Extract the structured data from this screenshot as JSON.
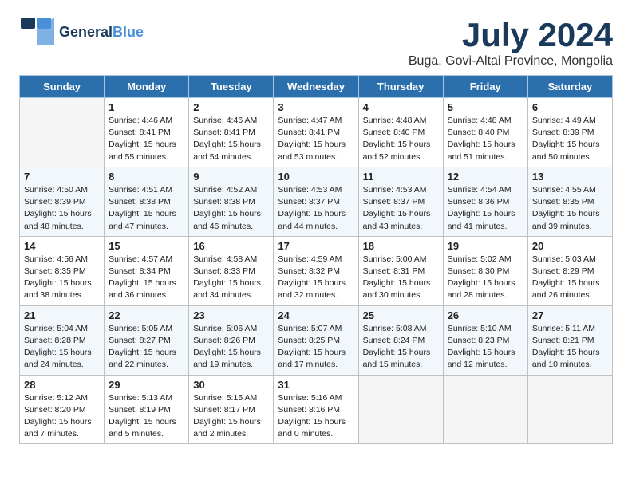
{
  "header": {
    "logo_general": "General",
    "logo_blue": "Blue",
    "month": "July 2024",
    "location": "Buga, Govi-Altai Province, Mongolia"
  },
  "days_of_week": [
    "Sunday",
    "Monday",
    "Tuesday",
    "Wednesday",
    "Thursday",
    "Friday",
    "Saturday"
  ],
  "weeks": [
    [
      {
        "day": "",
        "info": ""
      },
      {
        "day": "1",
        "info": "Sunrise: 4:46 AM\nSunset: 8:41 PM\nDaylight: 15 hours\nand 55 minutes."
      },
      {
        "day": "2",
        "info": "Sunrise: 4:46 AM\nSunset: 8:41 PM\nDaylight: 15 hours\nand 54 minutes."
      },
      {
        "day": "3",
        "info": "Sunrise: 4:47 AM\nSunset: 8:41 PM\nDaylight: 15 hours\nand 53 minutes."
      },
      {
        "day": "4",
        "info": "Sunrise: 4:48 AM\nSunset: 8:40 PM\nDaylight: 15 hours\nand 52 minutes."
      },
      {
        "day": "5",
        "info": "Sunrise: 4:48 AM\nSunset: 8:40 PM\nDaylight: 15 hours\nand 51 minutes."
      },
      {
        "day": "6",
        "info": "Sunrise: 4:49 AM\nSunset: 8:39 PM\nDaylight: 15 hours\nand 50 minutes."
      }
    ],
    [
      {
        "day": "7",
        "info": "Sunrise: 4:50 AM\nSunset: 8:39 PM\nDaylight: 15 hours\nand 48 minutes."
      },
      {
        "day": "8",
        "info": "Sunrise: 4:51 AM\nSunset: 8:38 PM\nDaylight: 15 hours\nand 47 minutes."
      },
      {
        "day": "9",
        "info": "Sunrise: 4:52 AM\nSunset: 8:38 PM\nDaylight: 15 hours\nand 46 minutes."
      },
      {
        "day": "10",
        "info": "Sunrise: 4:53 AM\nSunset: 8:37 PM\nDaylight: 15 hours\nand 44 minutes."
      },
      {
        "day": "11",
        "info": "Sunrise: 4:53 AM\nSunset: 8:37 PM\nDaylight: 15 hours\nand 43 minutes."
      },
      {
        "day": "12",
        "info": "Sunrise: 4:54 AM\nSunset: 8:36 PM\nDaylight: 15 hours\nand 41 minutes."
      },
      {
        "day": "13",
        "info": "Sunrise: 4:55 AM\nSunset: 8:35 PM\nDaylight: 15 hours\nand 39 minutes."
      }
    ],
    [
      {
        "day": "14",
        "info": "Sunrise: 4:56 AM\nSunset: 8:35 PM\nDaylight: 15 hours\nand 38 minutes."
      },
      {
        "day": "15",
        "info": "Sunrise: 4:57 AM\nSunset: 8:34 PM\nDaylight: 15 hours\nand 36 minutes."
      },
      {
        "day": "16",
        "info": "Sunrise: 4:58 AM\nSunset: 8:33 PM\nDaylight: 15 hours\nand 34 minutes."
      },
      {
        "day": "17",
        "info": "Sunrise: 4:59 AM\nSunset: 8:32 PM\nDaylight: 15 hours\nand 32 minutes."
      },
      {
        "day": "18",
        "info": "Sunrise: 5:00 AM\nSunset: 8:31 PM\nDaylight: 15 hours\nand 30 minutes."
      },
      {
        "day": "19",
        "info": "Sunrise: 5:02 AM\nSunset: 8:30 PM\nDaylight: 15 hours\nand 28 minutes."
      },
      {
        "day": "20",
        "info": "Sunrise: 5:03 AM\nSunset: 8:29 PM\nDaylight: 15 hours\nand 26 minutes."
      }
    ],
    [
      {
        "day": "21",
        "info": "Sunrise: 5:04 AM\nSunset: 8:28 PM\nDaylight: 15 hours\nand 24 minutes."
      },
      {
        "day": "22",
        "info": "Sunrise: 5:05 AM\nSunset: 8:27 PM\nDaylight: 15 hours\nand 22 minutes."
      },
      {
        "day": "23",
        "info": "Sunrise: 5:06 AM\nSunset: 8:26 PM\nDaylight: 15 hours\nand 19 minutes."
      },
      {
        "day": "24",
        "info": "Sunrise: 5:07 AM\nSunset: 8:25 PM\nDaylight: 15 hours\nand 17 minutes."
      },
      {
        "day": "25",
        "info": "Sunrise: 5:08 AM\nSunset: 8:24 PM\nDaylight: 15 hours\nand 15 minutes."
      },
      {
        "day": "26",
        "info": "Sunrise: 5:10 AM\nSunset: 8:23 PM\nDaylight: 15 hours\nand 12 minutes."
      },
      {
        "day": "27",
        "info": "Sunrise: 5:11 AM\nSunset: 8:21 PM\nDaylight: 15 hours\nand 10 minutes."
      }
    ],
    [
      {
        "day": "28",
        "info": "Sunrise: 5:12 AM\nSunset: 8:20 PM\nDaylight: 15 hours\nand 7 minutes."
      },
      {
        "day": "29",
        "info": "Sunrise: 5:13 AM\nSunset: 8:19 PM\nDaylight: 15 hours\nand 5 minutes."
      },
      {
        "day": "30",
        "info": "Sunrise: 5:15 AM\nSunset: 8:17 PM\nDaylight: 15 hours\nand 2 minutes."
      },
      {
        "day": "31",
        "info": "Sunrise: 5:16 AM\nSunset: 8:16 PM\nDaylight: 15 hours\nand 0 minutes."
      },
      {
        "day": "",
        "info": ""
      },
      {
        "day": "",
        "info": ""
      },
      {
        "day": "",
        "info": ""
      }
    ]
  ]
}
